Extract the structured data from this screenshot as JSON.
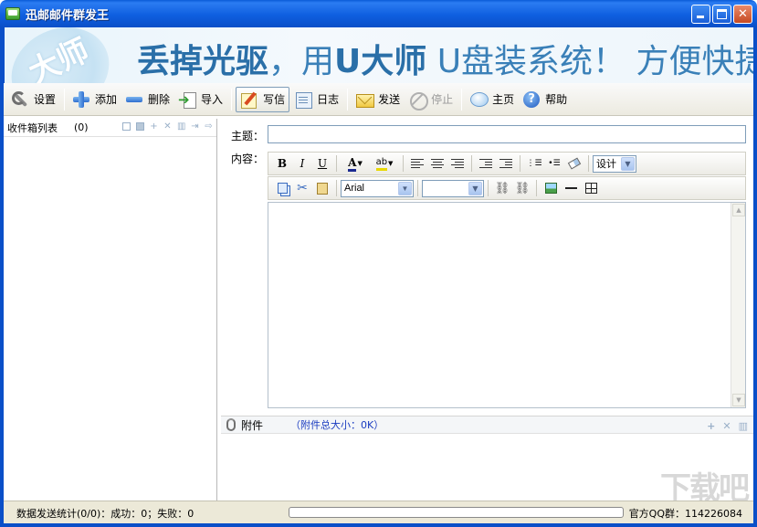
{
  "window": {
    "title": "迅邮邮件群发王"
  },
  "banner": {
    "logo_text": "大师",
    "slogan_part1": "丢掉光驱",
    "slogan_part2": "，用",
    "slogan_part3": "U大师",
    "slogan_part4": " U盘装系统！ 方便快捷"
  },
  "toolbar": {
    "settings": "设置",
    "add": "添加",
    "delete": "删除",
    "import": "导入",
    "write": "写信",
    "log": "日志",
    "send": "发送",
    "stop": "停止",
    "home": "主页",
    "help": "帮助"
  },
  "left_panel": {
    "title": "收件箱列表",
    "count": "(0)"
  },
  "compose": {
    "subject_label": "主题：",
    "subject_value": "",
    "content_label": "内容：",
    "mode_value": "设计",
    "font_value": "Arial",
    "size_value": "",
    "content_value": ""
  },
  "attachments": {
    "label": "附件",
    "total_size": "（附件总大小：0K）"
  },
  "watermark": "下载吧",
  "status": {
    "stats": "数据发送统计(0/0)：成功：0；失败：0",
    "progress": 0,
    "qq": "官方QQ群：114226084"
  }
}
